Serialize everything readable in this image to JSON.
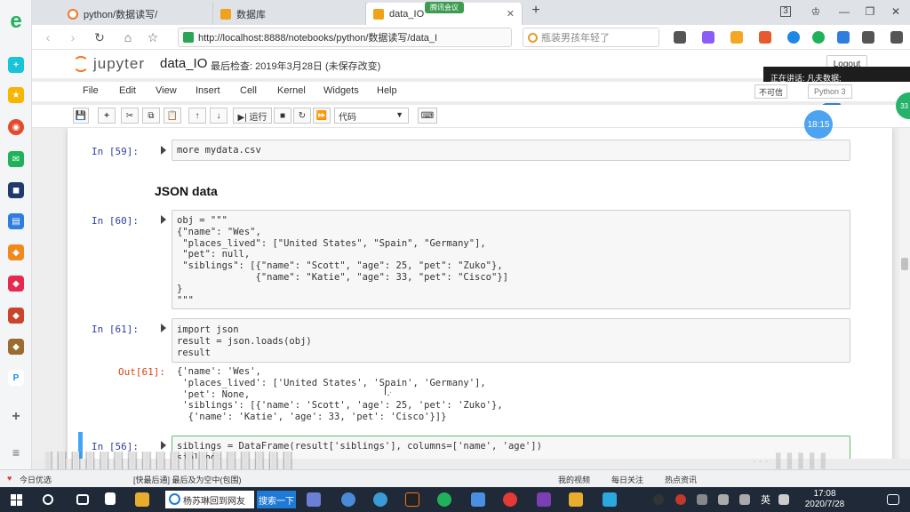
{
  "browser": {
    "tabs": [
      {
        "title": "python/数据读写/",
        "active": false
      },
      {
        "title": "数据库",
        "active": false
      },
      {
        "title": "data_IO",
        "active": true
      }
    ],
    "meeting_badge": "腾讯会议",
    "new_tab": "+",
    "window_controls": {
      "minimize": "—",
      "restore": "❐",
      "close": "✕",
      "tab_count": "3"
    },
    "url": "http://localhost:8888/notebooks/python/数据读写/data_I",
    "search_placeholder": "瓶装男孩年轻了",
    "nav": {
      "back": "‹",
      "forward": "›",
      "reload": "↻",
      "home": "⌂",
      "star": "☆"
    }
  },
  "jupyter": {
    "logo_text": "jupyter",
    "notebook_name": "data_IO",
    "checkpoint": "最后检查: 2019年3月28日 (未保存改变)",
    "logout": "Logout",
    "menu": [
      "File",
      "Edit",
      "View",
      "Insert",
      "Cell",
      "Kernel",
      "Widgets",
      "Help"
    ],
    "trusted": "不可信",
    "kernel": "Python 3",
    "toolbar": {
      "save": "💾",
      "add": "+",
      "cut": "✂",
      "copy": "⧉",
      "paste": "📋",
      "up": "↑",
      "down": "↓",
      "run": "▶| 运行",
      "stop": "■",
      "restart": "↻",
      "fast_forward": "⏩",
      "cell_type": "代码",
      "cell_type_caret": "▼",
      "keyboard": "⌨"
    },
    "tooltip": "正在讲话: 凡夫数据;",
    "clock_bubble": "18:15",
    "green_edge": "33",
    "heading": "JSON data",
    "cells": [
      {
        "prompt": "In [59]:",
        "lines": [
          "more mydata.csv"
        ]
      },
      {
        "prompt": "In [60]:",
        "lines": [
          "obj = \"\"\"",
          "{\"name\": \"Wes\",",
          " \"places_lived\": [\"United States\", \"Spain\", \"Germany\"],",
          " \"pet\": null,",
          " \"siblings\": [{\"name\": \"Scott\", \"age\": 25, \"pet\": \"Zuko\"},",
          "              {\"name\": \"Katie\", \"age\": 33, \"pet\": \"Cisco\"}]",
          "}",
          "\"\"\""
        ]
      },
      {
        "prompt": "In [61]:",
        "lines": [
          "import json",
          "result = json.loads(obj)",
          "result"
        ]
      },
      {
        "prompt": "In [56]:",
        "lines": [
          "siblings = DataFrame(result['siblings'], columns=['name', 'age'])",
          "siblings"
        ]
      }
    ],
    "output": {
      "prompt": "Out[61]:",
      "lines": [
        "{'name': 'Wes',",
        " 'places_lived': ['United States', 'Spain', 'Germany'],",
        " 'pet': None,",
        " 'siblings': [{'name': 'Scott', 'age': 25, 'pet': 'Zuko'},",
        "  {'name': 'Katie', 'age': 33, 'pet': 'Cisco'}]}"
      ]
    }
  },
  "overlay": {
    "subtitle": "▌▌▌▌▌▌▌▌▌▌▌▌▌▌▌▌▌▌",
    "watermark": "··· ▌▌▌▌▌"
  },
  "statusbar": {
    "left": "今日优选",
    "middle": "[快最后通] 最后及为空中(包围)",
    "right": [
      "我的视频",
      "每日关注",
      "热点资讯"
    ]
  },
  "taskbar": {
    "browser_label": "杨苏琳回到网友",
    "search_label": "搜索一下",
    "lang": "英",
    "time": "17:08",
    "date": "2020/7/28"
  },
  "colors": {
    "accent": "#f37626",
    "cell_border": "#cfcfcf",
    "prompt_in": "#303f9f",
    "prompt_out": "#d84315"
  }
}
